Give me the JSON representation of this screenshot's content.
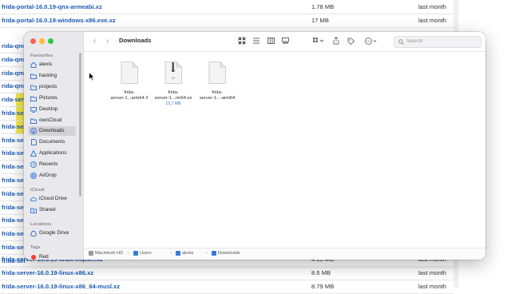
{
  "background_listing": {
    "rows": [
      {
        "name": "frida-portal-16.0.19-qnx-armeabi.xz",
        "size": "1.78 MB",
        "date": "last month"
      },
      {
        "name": "frida-portal-16.0.19-windows-x86.exe.xz",
        "size": "17 MB",
        "date": "last month"
      },
      {
        "name": "rida-qmi",
        "size": "",
        "date": ""
      },
      {
        "name": "rida-qmi",
        "size": "",
        "date": ""
      },
      {
        "name": "rida-qmi",
        "size": "",
        "date": ""
      },
      {
        "name": "rida-qmi",
        "size": "",
        "date": ""
      },
      {
        "name": "rida-ser",
        "size": "",
        "date": ""
      },
      {
        "name": "frida-ser",
        "size": "",
        "date": ""
      },
      {
        "name": "frida-ser",
        "size": "",
        "date": ""
      },
      {
        "name": "frida-ser",
        "size": "",
        "date": ""
      },
      {
        "name": "frida-ser",
        "size": "",
        "date": ""
      },
      {
        "name": "frida-ser",
        "size": "",
        "date": ""
      },
      {
        "name": "frida-ser",
        "size": "",
        "date": ""
      },
      {
        "name": "frida-ser",
        "size": "",
        "date": ""
      },
      {
        "name": "frida-ser",
        "size": "",
        "date": ""
      },
      {
        "name": "frida-ser",
        "size": "",
        "date": ""
      },
      {
        "name": "frida-ser",
        "size": "",
        "date": ""
      },
      {
        "name": "frida-ser",
        "size": "",
        "date": ""
      },
      {
        "name": "frida-ser",
        "size": "",
        "date": ""
      },
      {
        "name": "frida-server-16.0.19-linux-mipsel.xz",
        "size": "4.19 MB",
        "date": "last month"
      },
      {
        "name": "frida-server-16.0.19-linux-x86.xz",
        "size": "8.6 MB",
        "date": "last month"
      },
      {
        "name": "frida-server-16.0.19-linux-x86_64-musl.xz",
        "size": "8.79 MB",
        "date": "last month"
      }
    ]
  },
  "finder": {
    "title": "Downloads",
    "nav": {
      "back": "‹",
      "forward": "›"
    },
    "search_placeholder": "Search",
    "sidebar": {
      "sections": {
        "favourites": "Favourites",
        "icloud": "iCloud",
        "locations": "Locations",
        "tags": "Tags"
      },
      "favourites": [
        {
          "label": "alexis",
          "icon": "home-icon"
        },
        {
          "label": "hacking",
          "icon": "folder-icon"
        },
        {
          "label": "projects",
          "icon": "folder-icon"
        },
        {
          "label": "Pictures",
          "icon": "folder-icon"
        },
        {
          "label": "Desktop",
          "icon": "desktop-icon"
        },
        {
          "label": "ownCloud",
          "icon": "folder-icon"
        },
        {
          "label": "Downloads",
          "icon": "downloads-icon"
        },
        {
          "label": "Documents",
          "icon": "documents-icon"
        },
        {
          "label": "Applications",
          "icon": "applications-icon"
        },
        {
          "label": "Recents",
          "icon": "clock-icon"
        },
        {
          "label": "AirDrop",
          "icon": "airdrop-icon"
        }
      ],
      "icloud": [
        {
          "label": "iCloud Drive",
          "icon": "cloud-icon"
        },
        {
          "label": "Shared",
          "icon": "shared-folder-icon"
        }
      ],
      "locations": [
        {
          "label": "Google Drive",
          "icon": "drive-icon"
        }
      ],
      "tags": [
        {
          "label": "Red",
          "color": "#ff3b30"
        }
      ]
    },
    "files": [
      {
        "name_line1": "frida-",
        "name_line2": "server-1...arm64 2",
        "size": ""
      },
      {
        "name_line1": "frida-",
        "name_line2": "server-1...rm64.xz",
        "size": "19,7 MB",
        "badge": "xz"
      },
      {
        "name_line1": "frida-",
        "name_line2": "server-1...-arm64",
        "size": ""
      }
    ],
    "path": [
      "Macintosh HD",
      "Users",
      "alexis",
      "Downloads"
    ],
    "colors": {
      "accent": "#3a7bd5",
      "link": "#1d5bb5",
      "highlight": "#f5e94a"
    }
  }
}
